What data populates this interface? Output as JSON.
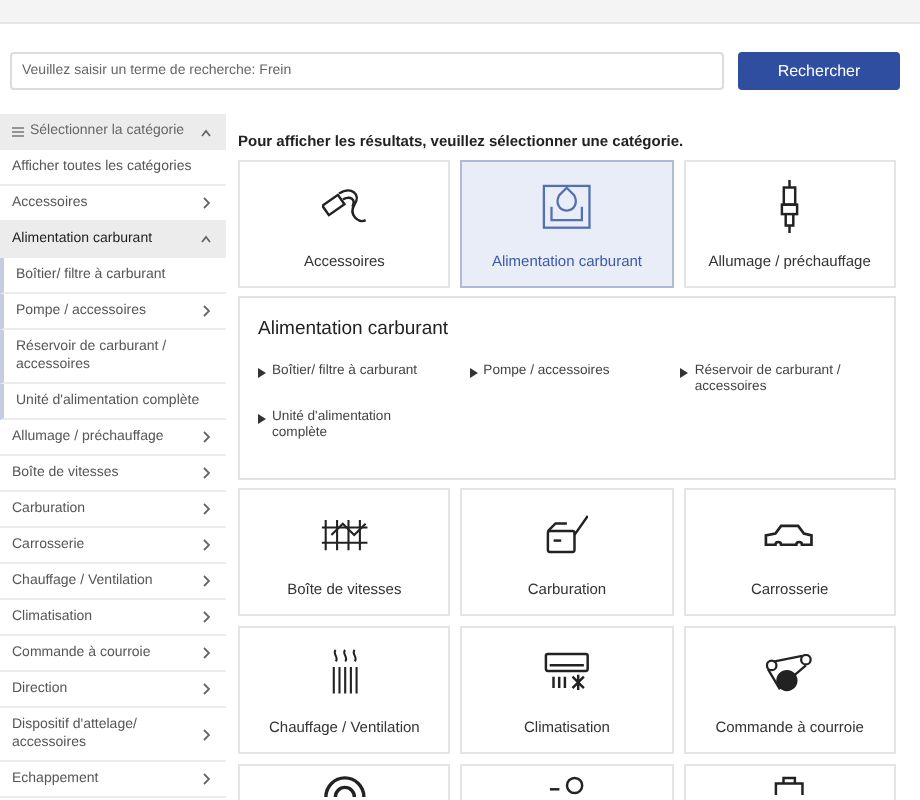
{
  "search": {
    "placeholder": "Veuillez saisir un terme de recherche: Frein",
    "button": "Rechercher"
  },
  "sidebar": {
    "title": "Sélectionner la catégorie",
    "expanded": true,
    "items": [
      {
        "label": "Afficher toutes les catégories",
        "kind": "link"
      },
      {
        "label": "Accessoires",
        "kind": "category",
        "expanded": false
      },
      {
        "label": "Alimentation carburant",
        "kind": "category",
        "expanded": true,
        "children": [
          {
            "label": "Boîtier/ filtre à carburant",
            "kind": "link"
          },
          {
            "label": "Pompe / accessoires",
            "kind": "category",
            "expanded": false
          },
          {
            "label": "Réservoir de carburant / accessoires",
            "kind": "link"
          },
          {
            "label": "Unité d'alimentation complète",
            "kind": "link"
          }
        ]
      },
      {
        "label": "Allumage / préchauffage",
        "kind": "category",
        "expanded": false
      },
      {
        "label": "Boîte de vitesses",
        "kind": "category",
        "expanded": false
      },
      {
        "label": "Carburation",
        "kind": "category",
        "expanded": false
      },
      {
        "label": "Carrosserie",
        "kind": "category",
        "expanded": false
      },
      {
        "label": "Chauffage / Ventilation",
        "kind": "category",
        "expanded": false
      },
      {
        "label": "Climatisation",
        "kind": "category",
        "expanded": false
      },
      {
        "label": "Commande à courroie",
        "kind": "category",
        "expanded": false
      },
      {
        "label": "Direction",
        "kind": "category",
        "expanded": false
      },
      {
        "label": "Dispositif d'attelage/ accessoires",
        "kind": "category",
        "expanded": false
      },
      {
        "label": "Echappement",
        "kind": "category",
        "expanded": false
      }
    ]
  },
  "heading": "Pour afficher les résultats, veuillez sélectionner une catégorie.",
  "tiles_top": [
    {
      "label": "Accessoires",
      "selected": false
    },
    {
      "label": "Alimentation carburant",
      "selected": true
    },
    {
      "label": "Allumage / préchauffage",
      "selected": false
    }
  ],
  "panel": {
    "title": "Alimentation carburant",
    "links": [
      "Boîtier/ filtre à carburant",
      "Pompe / accessoires",
      "Réservoir de carburant / accessoires",
      "Unité d'alimentation complète"
    ]
  },
  "tiles_bottom": [
    {
      "label": "Boîte de vitesses",
      "selected": false
    },
    {
      "label": "Carburation",
      "selected": false
    },
    {
      "label": "Carrosserie",
      "selected": false
    },
    {
      "label": "Chauffage / Ventilation",
      "selected": false
    },
    {
      "label": "Climatisation",
      "selected": false
    },
    {
      "label": "Commande à courroie",
      "selected": false
    },
    {
      "selected": false
    },
    {
      "selected": false
    },
    {
      "selected": false
    }
  ]
}
